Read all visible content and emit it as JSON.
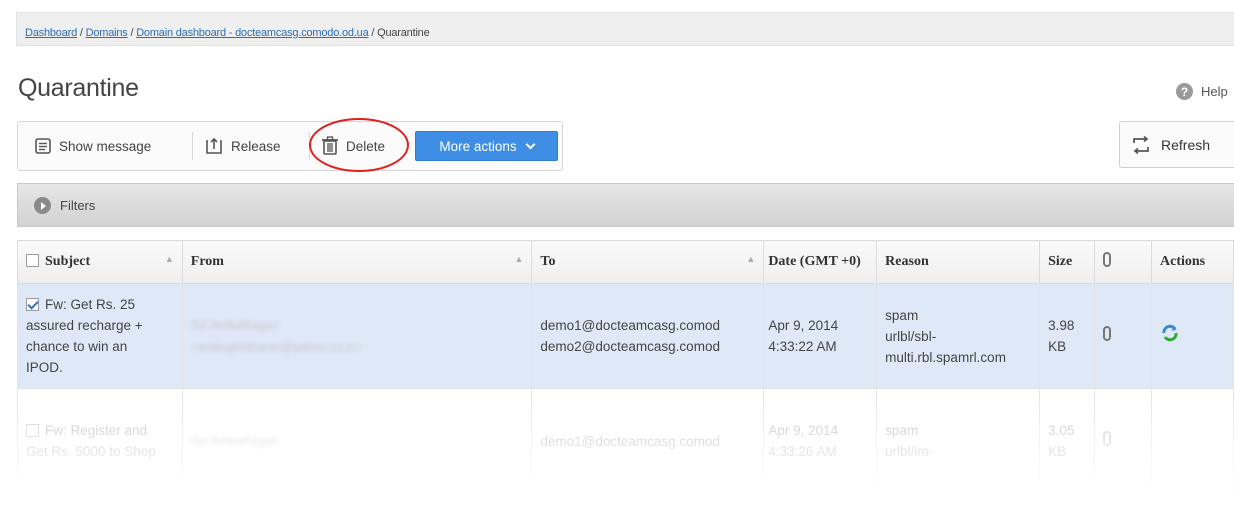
{
  "breadcrumb": {
    "items": [
      "Dashboard",
      "Domains",
      "Domain dashboard - docteamcasg.comodo.od.ua"
    ],
    "current": "Quarantine",
    "sep": " / "
  },
  "page": {
    "title": "Quarantine",
    "help_label": "Help"
  },
  "toolbar": {
    "show_message": "Show message",
    "release": "Release",
    "delete": "Delete",
    "more_actions": "More actions",
    "refresh": "Refresh"
  },
  "filters": {
    "label": "Filters"
  },
  "table": {
    "columns": {
      "subject": "Subject",
      "from": "From",
      "to": "To",
      "date": "Date (GMT +0)",
      "reason": "Reason",
      "size": "Size",
      "actions": "Actions"
    },
    "rows": [
      {
        "checked": true,
        "subject": [
          "Fw: Get Rs. 25",
          "assured recharge +",
          "chance to win an",
          "IPOD."
        ],
        "from": [
          "Siri Ambathagan",
          "<ambughidharan@yahoo.co.in>"
        ],
        "to": [
          "demo1@docteamcasg.comod",
          "demo2@docteamcasg.comod"
        ],
        "date": [
          "Apr 9, 2014",
          "4:33:22 AM"
        ],
        "reason": [
          "spam",
          "urlbl/sbl-",
          "multi.rbl.spamrl.com"
        ],
        "size": [
          "3.98",
          "KB"
        ]
      },
      {
        "checked": false,
        "subject": [
          "Fw: Register and",
          "Get Rs. 5000 to Shop",
          ""
        ],
        "from": [
          "Siri Ambathagan",
          ""
        ],
        "to": [
          "demo1@docteamcasg.comod",
          ""
        ],
        "date": [
          "Apr 9, 2014",
          "4:33:26 AM"
        ],
        "reason": [
          "spam",
          "urlbl/im-",
          ""
        ],
        "size": [
          "3.05",
          "KB"
        ]
      }
    ]
  },
  "colors": {
    "accent": "#3f8ee6",
    "selected_row": "#dfe8f7",
    "highlight": "#e0201d"
  }
}
